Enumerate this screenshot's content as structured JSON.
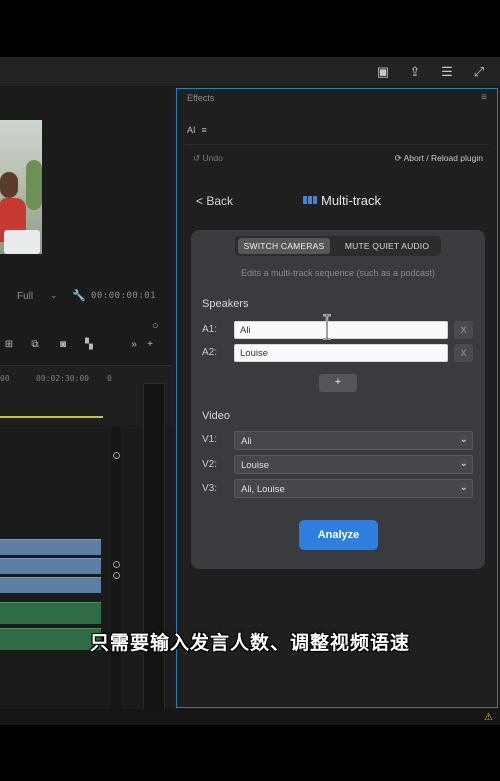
{
  "panel": {
    "title": "Effects",
    "ai_tab": "AI",
    "undo": "↺ Undo",
    "abort": "⟳ Abort / Reload plugin",
    "back": "< Back",
    "heading": "Multi-track"
  },
  "modes": {
    "active": "SWITCH CAMERAS",
    "inactive": "MUTE QUIET AUDIO"
  },
  "description": "Edits a multi-track sequence (such as a podcast)",
  "speakers": {
    "label": "Speakers",
    "rows": [
      {
        "track": "A1:",
        "value": "Ali",
        "remove": "X"
      },
      {
        "track": "A2:",
        "value": "Louise",
        "remove": "X"
      }
    ],
    "add": "+"
  },
  "video": {
    "label": "Video",
    "rows": [
      {
        "track": "V1:",
        "value": "Ali"
      },
      {
        "track": "V2:",
        "value": "Louise"
      },
      {
        "track": "V3:",
        "value": "Ali, Louise"
      }
    ]
  },
  "analyze": "Analyze",
  "monitor": {
    "zoom": "Full",
    "timecode": "00:00:00:01"
  },
  "timeline": {
    "ticks": [
      "00",
      "00:02:30:00",
      "0"
    ]
  },
  "subtitle": "只需要输入发言人数、调整视频语速",
  "colors": {
    "accent": "#2f7fe0",
    "panel_border": "#2a7fb6",
    "video_track": "#5d7ea3",
    "audio_track": "#2f6b45"
  }
}
